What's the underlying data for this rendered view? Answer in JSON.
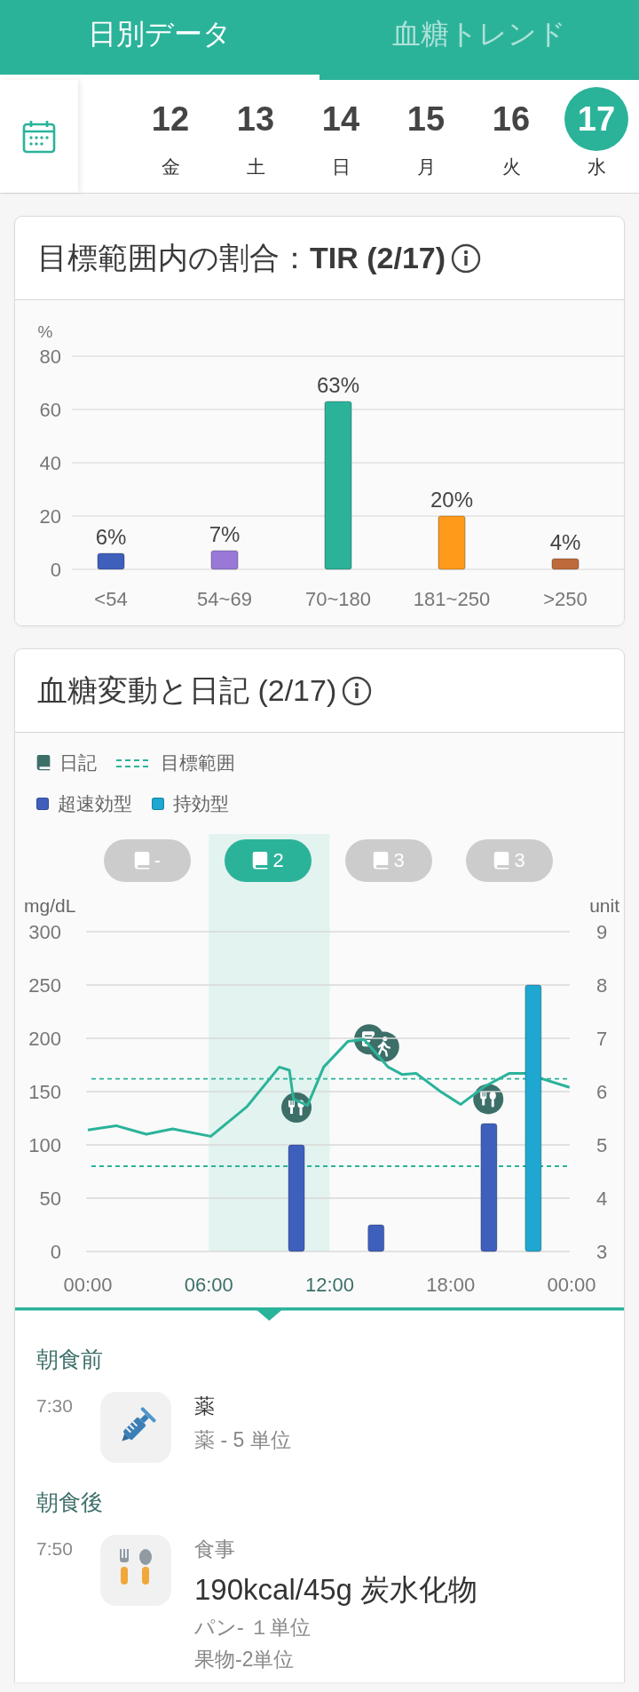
{
  "tabs": [
    {
      "label": "日別データ",
      "selected": true
    },
    {
      "label": "血糖トレンド",
      "selected": false
    }
  ],
  "date_strip": {
    "days": [
      {
        "day": "12",
        "weekday": "金",
        "selected": false
      },
      {
        "day": "13",
        "weekday": "土",
        "selected": false
      },
      {
        "day": "14",
        "weekday": "日",
        "selected": false
      },
      {
        "day": "15",
        "weekday": "月",
        "selected": false
      },
      {
        "day": "16",
        "weekday": "火",
        "selected": false
      },
      {
        "day": "17",
        "weekday": "水",
        "selected": true
      }
    ]
  },
  "tir_card": {
    "title": "目標範囲内の割合：**TIR (2/17)**",
    "chart_data": {
      "type": "bar",
      "ylabel": "%",
      "categories": [
        "<54",
        "54~69",
        "70~180",
        "181~250",
        ">250"
      ],
      "ylim": [
        0,
        80
      ],
      "yticks": [
        0,
        20,
        40,
        60,
        80
      ],
      "grid": true,
      "series": [
        {
          "colors": [
            "#3f5fbd",
            "#9a78d8",
            "#2bb39a",
            "#ff9a1a",
            "#bf6a3a"
          ],
          "values": [
            6,
            7,
            63,
            20,
            4
          ]
        }
      ],
      "value_labels": [
        "6%",
        "7%",
        "63%",
        "20%",
        "4%"
      ]
    }
  },
  "glucose_card": {
    "title": "血糖変動と日記 (2/17)",
    "legend": [
      {
        "kind": "diary",
        "label": "日記"
      },
      {
        "kind": "target",
        "label": "目標範囲"
      },
      {
        "kind": "swatch",
        "label": "超速効型",
        "color": "#3f5fbd"
      },
      {
        "kind": "swatch",
        "label": "持効型",
        "color": "#1ea7d0"
      }
    ],
    "period_pills": [
      {
        "label": "-",
        "selected": false
      },
      {
        "label": "2",
        "selected": true
      },
      {
        "label": "3",
        "selected": false
      },
      {
        "label": "3",
        "selected": false
      }
    ],
    "diary_markers": [
      {
        "kind": "meal"
      },
      {
        "kind": "note"
      },
      {
        "kind": "walk"
      },
      {
        "kind": "meal"
      }
    ],
    "glucose_chart": {
      "chart_data": {
        "type": "line",
        "ylabel": "mg/dL",
        "xlim": [
          0,
          24
        ],
        "ylim": [
          0,
          300
        ],
        "yticks": [
          0,
          50,
          100,
          150,
          200,
          250,
          300
        ],
        "grid": true,
        "xticks": [
          {
            "value": 0,
            "label": "00:00"
          },
          {
            "value": 6,
            "label": "06:00"
          },
          {
            "value": 12,
            "label": "12:00"
          },
          {
            "value": 18,
            "label": "18:00"
          },
          {
            "value": 24,
            "label": "00:00"
          }
        ],
        "x": [
          0,
          1.4,
          2.9,
          4.2,
          6.1,
          7.9,
          9.5,
          10,
          10.2,
          10.9,
          11.7,
          12.9,
          13.7,
          14.9,
          15.6,
          16.3,
          17.5,
          18.5,
          19.7,
          20.9,
          21.7,
          23.9
        ],
        "series": [
          {
            "color": "#2bb39a",
            "values": [
              114,
              118,
              110,
              115,
              108,
              136,
              173,
              170,
              143,
              137,
              173,
              197,
              199,
              173,
              166,
              167,
              150,
              138,
              155,
              167,
              167,
              154
            ]
          }
        ]
      }
    },
    "insulin_chart": {
      "chart_data": {
        "type": "bar",
        "ylabel": "unit",
        "categories": [
          null,
          null,
          null,
          null
        ],
        "ylim": [
          3,
          9
        ],
        "yticks": [
          3,
          4,
          5,
          6,
          7,
          8,
          9
        ],
        "series": [
          {
            "colors": [
              "#3f5fbd",
              "#3f5fbd",
              "#3f5fbd",
              "#1ea7d0"
            ],
            "values": [
              5,
              3.5,
              5.4,
              8
            ]
          }
        ]
      }
    },
    "diary": [
      {
        "heading": "朝食前",
        "entries": [
          {
            "kind": "medicine",
            "time": "7:30",
            "title": "薬",
            "details": [
              "薬 - 5 単位"
            ]
          }
        ]
      },
      {
        "heading": "朝食後",
        "entries": [
          {
            "kind": "meal",
            "time": "7:50",
            "category": "食事",
            "headline": "190kcal/45g 炭水化物",
            "details": [
              "パン- １単位",
              "果物-2単位"
            ]
          }
        ]
      }
    ]
  }
}
